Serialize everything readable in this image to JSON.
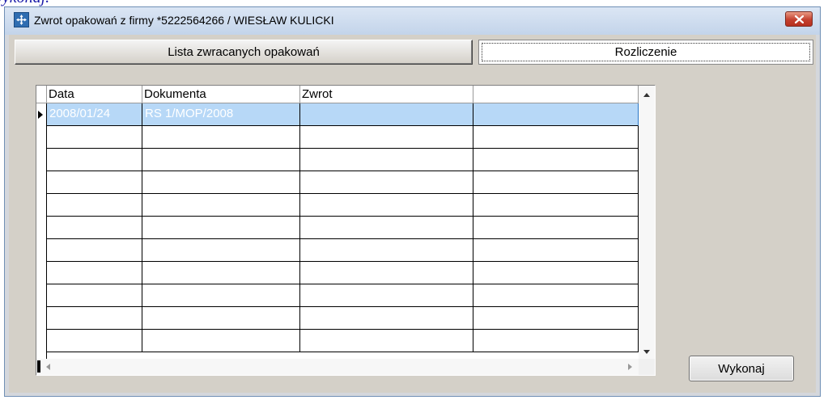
{
  "background_caption": "Wykonaj.",
  "window": {
    "title": "Zwrot opakowań z firmy *5222564266 / WIESŁAW KULICKI",
    "icon": "app-move-icon",
    "close_icon": "close-icon"
  },
  "tabs": [
    {
      "label": "Lista zwracanych opakowań",
      "active": false
    },
    {
      "label": "Rozliczenie",
      "active": true
    }
  ],
  "grid": {
    "columns": [
      "Data",
      "Dokumenta",
      "Zwrot",
      ""
    ],
    "rows": [
      {
        "cells": [
          "2008/01/24",
          "RS 1/MOP/2008",
          "",
          ""
        ],
        "selected": true
      },
      {
        "cells": [
          "",
          "",
          "",
          ""
        ]
      },
      {
        "cells": [
          "",
          "",
          "",
          ""
        ]
      },
      {
        "cells": [
          "",
          "",
          "",
          ""
        ]
      },
      {
        "cells": [
          "",
          "",
          "",
          ""
        ]
      },
      {
        "cells": [
          "",
          "",
          "",
          ""
        ]
      },
      {
        "cells": [
          "",
          "",
          "",
          ""
        ]
      },
      {
        "cells": [
          "",
          "",
          "",
          ""
        ]
      },
      {
        "cells": [
          "",
          "",
          "",
          ""
        ]
      },
      {
        "cells": [
          "",
          "",
          "",
          ""
        ]
      },
      {
        "cells": [
          "",
          "",
          "",
          ""
        ]
      }
    ]
  },
  "actions": {
    "execute_label": "Wykonaj"
  },
  "colors": {
    "selection": "#b7d8f7",
    "close_button": "#c4412f",
    "dialog": "#d4d0c8"
  }
}
